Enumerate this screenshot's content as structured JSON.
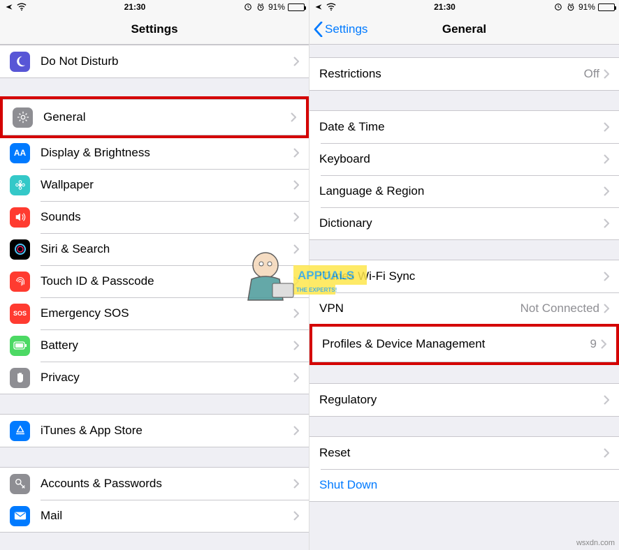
{
  "status": {
    "time": "21:30",
    "battery_pct": "91%"
  },
  "left": {
    "title": "Settings",
    "rows": {
      "dnd": "Do Not Disturb",
      "general": "General",
      "display": "Display & Brightness",
      "wallpaper": "Wallpaper",
      "sounds": "Sounds",
      "siri": "Siri & Search",
      "touchid": "Touch ID & Passcode",
      "sos": "Emergency SOS",
      "battery": "Battery",
      "privacy": "Privacy",
      "itunes": "iTunes & App Store",
      "accounts": "Accounts & Passwords",
      "mail": "Mail"
    }
  },
  "right": {
    "back": "Settings",
    "title": "General",
    "rows": {
      "restrictions": "Restrictions",
      "restrictions_val": "Off",
      "date": "Date & Time",
      "keyboard": "Keyboard",
      "language": "Language & Region",
      "dictionary": "Dictionary",
      "wifi": "iTunes Wi-Fi Sync",
      "vpn": "VPN",
      "vpn_val": "Not Connected",
      "profiles": "Profiles & Device Management",
      "profiles_val": "9",
      "regulatory": "Regulatory",
      "reset": "Reset",
      "shutdown": "Shut Down"
    }
  },
  "watermark": {
    "brand": "APPUALS",
    "tag": "THE EXPERTS!"
  },
  "credit": "wsxdn.com"
}
